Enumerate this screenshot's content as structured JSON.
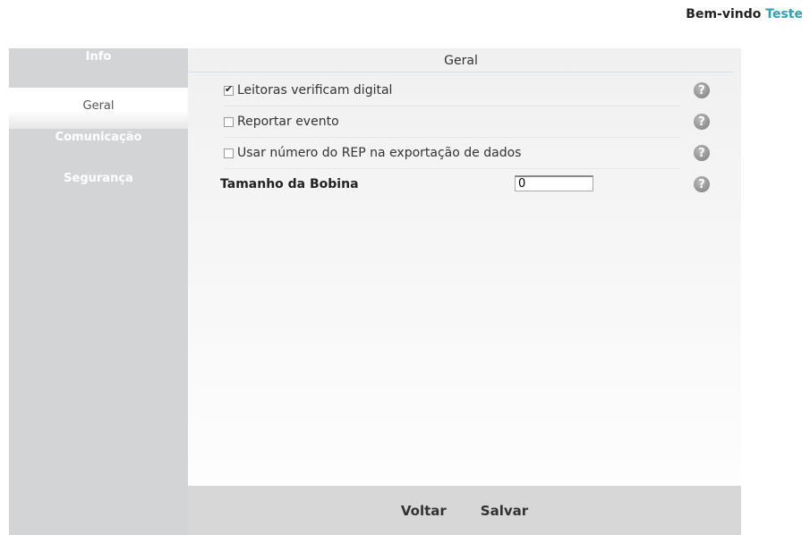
{
  "header": {
    "welcome_label": "Bem-vindo",
    "user_name": "Teste"
  },
  "sidebar": {
    "items": [
      {
        "label": "Info"
      },
      {
        "label": "Geral"
      },
      {
        "label": "Comunicação"
      },
      {
        "label": "Segurança"
      }
    ],
    "active_index": 1
  },
  "main": {
    "title": "Geral",
    "options": [
      {
        "label": "Leitoras verificam digital",
        "checked": true
      },
      {
        "label": "Reportar evento",
        "checked": false
      },
      {
        "label": "Usar número do REP na exportação de dados",
        "checked": false
      }
    ],
    "bobina": {
      "label": "Tamanho da Bobina",
      "value": "0"
    },
    "help_glyph": "?"
  },
  "footer": {
    "back_label": "Voltar",
    "save_label": "Salvar"
  },
  "colors": {
    "accent": "#2aa3b8",
    "sidebar_bg": "#d3d4d6",
    "footer_bg": "#d7d7d8"
  }
}
